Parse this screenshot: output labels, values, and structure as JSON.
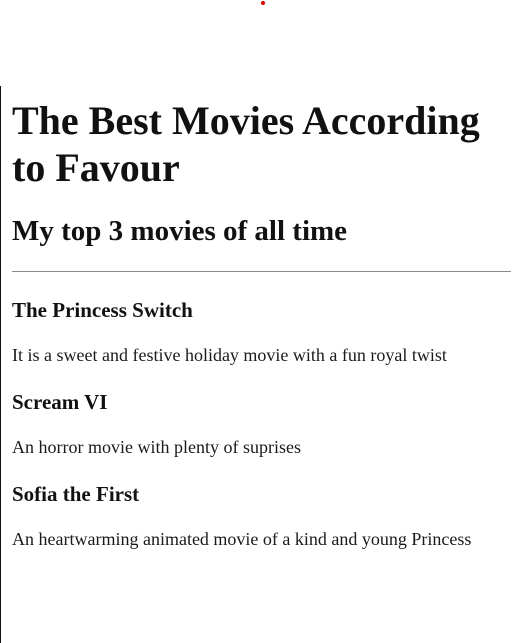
{
  "page": {
    "heading": "The Best Movies According to Favour",
    "subheading": "My top 3 movies of all time"
  },
  "movies": [
    {
      "title": "The Princess Switch",
      "description": "It is a sweet and festive holiday movie with a fun royal twist"
    },
    {
      "title": "Scream VI",
      "description": "An horror movie with plenty of suprises"
    },
    {
      "title": "Sofia the First",
      "description": "An heartwarming animated movie of a kind and young Princess"
    }
  ],
  "colors": {
    "accent_dot": "#e00000",
    "rule": "#8a8a8a",
    "text": "#111111"
  }
}
